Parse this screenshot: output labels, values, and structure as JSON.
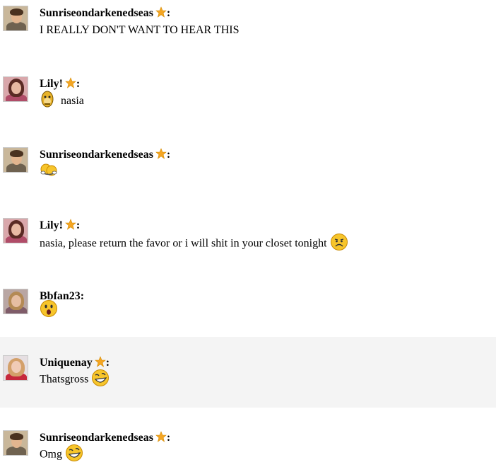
{
  "messages": [
    {
      "user": "Sunriseondarkenedseas",
      "star": true,
      "colon": ":",
      "text": "I REALLY DON'T WANT TO HEAR THIS",
      "emoticon_before": "",
      "emoticon_after": "",
      "avatar": "boy-brown",
      "highlight": false
    },
    {
      "user": "Lily!",
      "star": true,
      "colon": ":",
      "text": "nasia",
      "emoticon_before": "monkey-icon",
      "emoticon_after": "",
      "avatar": "girl-pink",
      "highlight": false
    },
    {
      "user": "Sunriseondarkenedseas",
      "star": true,
      "colon": ":",
      "text": "",
      "emoticon_before": "hug-emoticon-icon",
      "emoticon_after": "",
      "avatar": "boy-brown",
      "highlight": false
    },
    {
      "user": "Lily!",
      "star": true,
      "colon": ":",
      "text": "nasia, please return the favor or i will shit in your closet tonight",
      "emoticon_before": "",
      "emoticon_after": "worried-face-icon",
      "avatar": "girl-pink",
      "highlight": false
    },
    {
      "user": "Bbfan23",
      "star": false,
      "colon": ":",
      "text": "",
      "emoticon_before": "surprised-face-icon",
      "emoticon_after": "",
      "avatar": "girl-blonde",
      "highlight": false
    },
    {
      "user": "Uniquenay",
      "star": true,
      "colon": ":",
      "text": "Thatsgross",
      "emoticon_before": "",
      "emoticon_after": "laughing-face-icon",
      "avatar": "girl-redhair",
      "highlight": true
    },
    {
      "user": "Sunriseondarkenedseas",
      "star": true,
      "colon": ":",
      "text": "Omg",
      "emoticon_before": "",
      "emoticon_after": "laughing-face-icon",
      "avatar": "boy-brown",
      "highlight": false
    }
  ],
  "colors": {
    "highlight_row": "#f4f4f4",
    "star": "#f5a623",
    "emoticon_yellow": "#f7c52b",
    "emoticon_outline": "#c88a00"
  }
}
